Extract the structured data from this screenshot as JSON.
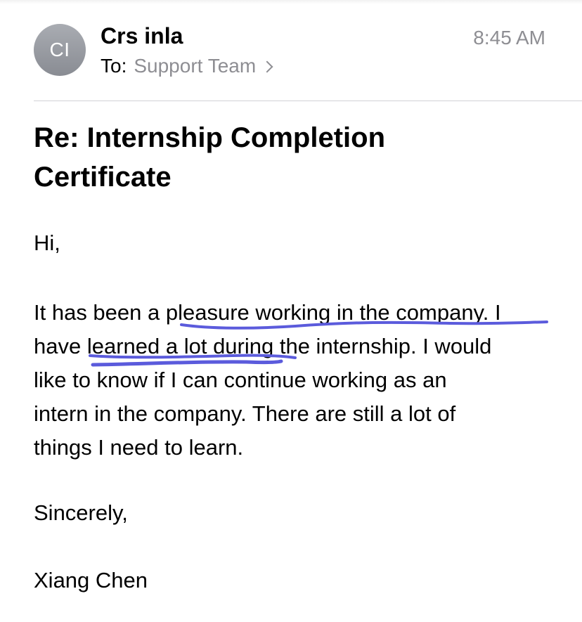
{
  "header": {
    "avatar_initials": "CI",
    "sender_name": "Crs inla",
    "to_label": "To:",
    "recipient": "Support Team",
    "time": "8:45 AM"
  },
  "email": {
    "subject": "Re: Internship Completion Certificate",
    "greeting": "Hi,",
    "body_lines": [
      "It has been a pleasure working in the company. I",
      "have learned a lot during the internship. I would",
      "like to know if I can continue working as an",
      "intern in the company. There are still a lot of",
      "things I need to learn."
    ],
    "closing": "Sincerely,",
    "signature": "Xiang Chen"
  },
  "annotations": {
    "underline_color": "#5b5bdc",
    "underlined_phrases": [
      "pleasure working in the company. I",
      "learned a lot during"
    ]
  }
}
